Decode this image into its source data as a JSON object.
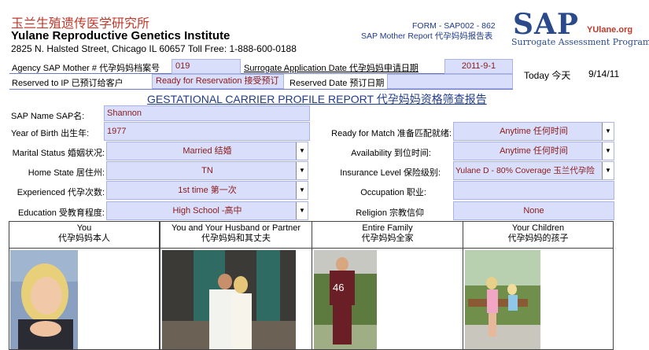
{
  "header": {
    "institute_cn": "玉兰生殖遗传医学研究所",
    "institute_en": "Yulane Reproductive Genetics Institute",
    "address": "2825 N. Halsted Street, Chicago IL 60657  Toll Free: 1-888-600-0188",
    "form_code": "FORM - SAP002 - 862",
    "form_title": "SAP Mother Report 代孕妈妈报告表"
  },
  "logo": {
    "sap": "SAP",
    "yulane": "YUlane.org",
    "subtitle": "Surrogate Assessment Program"
  },
  "agency": {
    "mother_label": "Agency SAP Mother  # 代孕妈妈档案号",
    "mother_value": "019",
    "app_date_label": "Surrogate Application Date 代孕妈妈申请日期",
    "app_date_value": "2011-9-1",
    "reserved_ip_label": "Reserved to IP  已预订给客户",
    "reserved_ip_value": "Ready for Reservation 接受预订",
    "reserved_date_label": "Reserved Date 预订日期",
    "reserved_date_value": "",
    "today_label": "Today 今天",
    "today_value": "9/14/11"
  },
  "report_title": "GESTATIONAL CARRIER PROFILE REPORT 代孕妈妈资格筛查报告",
  "left_fields": [
    {
      "label": "SAP Name SAP名:",
      "value": "Shannon"
    },
    {
      "label": "Year of Birth 出生年:",
      "value": "1977"
    },
    {
      "label": "Marital Status 婚姻状况:",
      "value": "Married 结婚"
    },
    {
      "label": "Home State 居住州:",
      "value": "TN"
    },
    {
      "label": "Experienced  代孕次数:",
      "value": "1st time  第一次"
    },
    {
      "label": "Education 受教育程度:",
      "value": "High School -高中"
    }
  ],
  "right_fields": [
    {
      "label": "Ready for Match 准备匹配就绪:",
      "value": "Anytime 任何时间"
    },
    {
      "label": "Availability 到位时间:",
      "value": "Anytime 任何时间"
    },
    {
      "label": "Insurance Level 保险级别:",
      "value": "Yulane D - 80% Coverage 玉兰代孕险"
    },
    {
      "label": "Occupation  职业:",
      "value": ""
    },
    {
      "label": "Religion 宗教信仰",
      "value": "None"
    }
  ],
  "photos": [
    {
      "en": "You",
      "cn": "代孕妈妈本人"
    },
    {
      "en": "You and Your Husband or Partner",
      "cn": "代孕妈妈和其丈夫"
    },
    {
      "en": "Entire Family",
      "cn": "代孕妈妈全家"
    },
    {
      "en": "Your Children",
      "cn": "代孕妈妈的孩子"
    }
  ],
  "colors": {
    "field_bg": "#d9defa",
    "value_red": "#8b1a1a",
    "header_blue": "#1f3b8c",
    "cn_red": "#c0392b"
  }
}
